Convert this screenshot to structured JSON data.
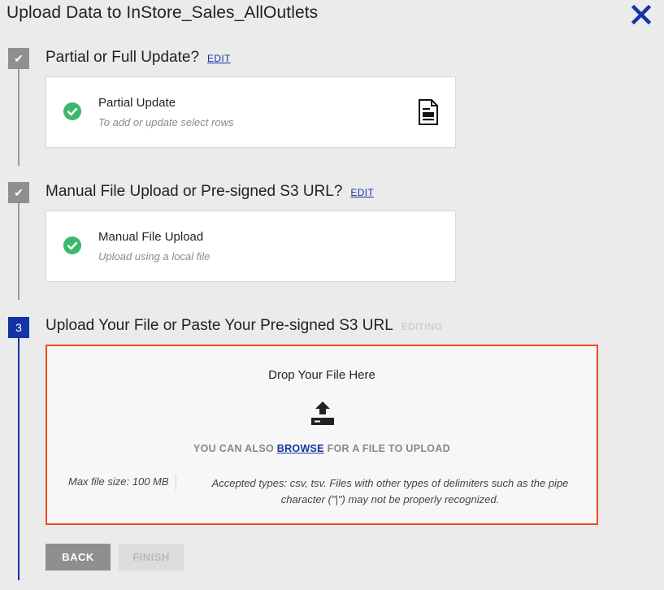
{
  "header": {
    "title": "Upload Data to InStore_Sales_AllOutlets"
  },
  "steps": [
    {
      "marker": "✔",
      "title": "Partial or Full Update?",
      "action": "EDIT",
      "card": {
        "title": "Partial Update",
        "subtitle": "To add or update select rows"
      }
    },
    {
      "marker": "✔",
      "title": "Manual File Upload or Pre-signed S3 URL?",
      "action": "EDIT",
      "card": {
        "title": "Manual File Upload",
        "subtitle": "Upload using a local file"
      }
    },
    {
      "marker": "3",
      "title": "Upload Your File or Paste Your Pre-signed S3 URL",
      "status": "EDITING"
    }
  ],
  "dropzone": {
    "title": "Drop Your File Here",
    "browse_prefix": "YOU CAN ALSO ",
    "browse_link": "BROWSE",
    "browse_suffix": " FOR A FILE TO UPLOAD",
    "max_size": "Max file size: 100 MB",
    "accepted_types": "Accepted types: csv, tsv. Files with other types of delimiters such as the pipe character (\"|\") may not be properly recognized."
  },
  "buttons": {
    "back": "BACK",
    "finish": "FINISH"
  },
  "colors": {
    "accent": "#1434a4",
    "dropzone_border": "#ee4b1c",
    "check_green": "#3cb86b",
    "step_done": "#8f8f8f"
  },
  "icons": [
    "close-icon",
    "checkmark-icon",
    "document-icon",
    "check-circle-icon",
    "upload-icon"
  ]
}
